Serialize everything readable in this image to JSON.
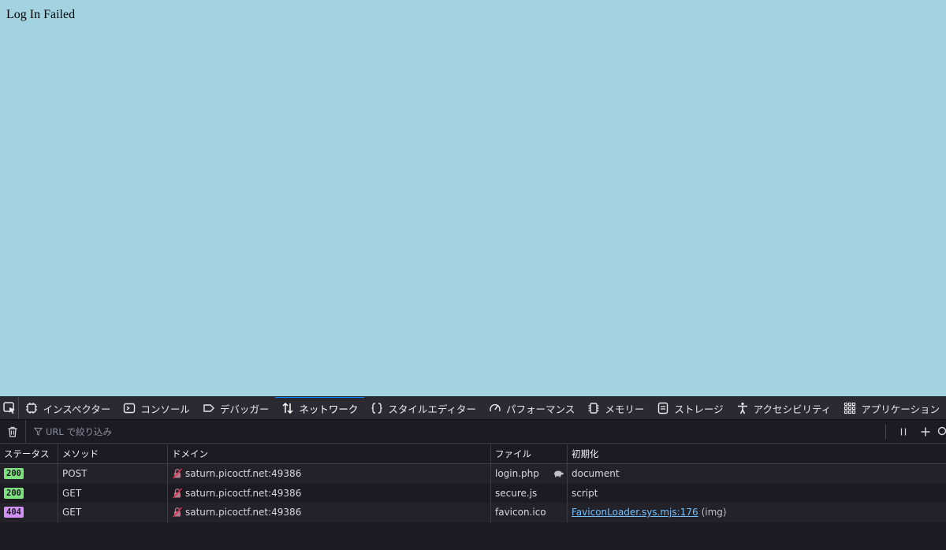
{
  "page": {
    "heading": "Log In Failed"
  },
  "devtools": {
    "tabs": [
      {
        "label": "インスペクター",
        "icon": "inspector-icon"
      },
      {
        "label": "コンソール",
        "icon": "console-icon"
      },
      {
        "label": "デバッガー",
        "icon": "debugger-icon"
      },
      {
        "label": "ネットワーク",
        "icon": "network-icon",
        "active": true
      },
      {
        "label": "スタイルエディター",
        "icon": "style-editor-icon"
      },
      {
        "label": "パフォーマンス",
        "icon": "performance-icon"
      },
      {
        "label": "メモリー",
        "icon": "memory-icon"
      },
      {
        "label": "ストレージ",
        "icon": "storage-icon"
      },
      {
        "label": "アクセシビリティ",
        "icon": "accessibility-icon"
      },
      {
        "label": "アプリケーション",
        "icon": "application-icon"
      }
    ],
    "filter": {
      "placeholder": "URL で絞り込み"
    },
    "columns": {
      "status": "ステータス",
      "method": "メソッド",
      "domain": "ドメイン",
      "file": "ファイル",
      "initiator": "初期化"
    },
    "requests": [
      {
        "status": "200",
        "status_color": "#7ee07e",
        "method": "POST",
        "domain": "saturn.picoctf.net:49386",
        "file": "login.php",
        "initiator": "document",
        "initiator_link": "",
        "initiator_type": "",
        "throttled": true
      },
      {
        "status": "200",
        "status_color": "#7ee07e",
        "method": "GET",
        "domain": "saturn.picoctf.net:49386",
        "file": "secure.js",
        "initiator": "script",
        "initiator_link": "",
        "initiator_type": "",
        "throttled": false
      },
      {
        "status": "404",
        "status_color": "#d291f7",
        "method": "GET",
        "domain": "saturn.picoctf.net:49386",
        "file": "favicon.ico",
        "initiator": "",
        "initiator_link": "FaviconLoader.sys.mjs:176",
        "initiator_type": "(img)",
        "throttled": false
      }
    ],
    "colors": {
      "accent": "#0a84ff",
      "page_background": "#a3d2e0",
      "panel_background": "#1c1b22"
    }
  }
}
